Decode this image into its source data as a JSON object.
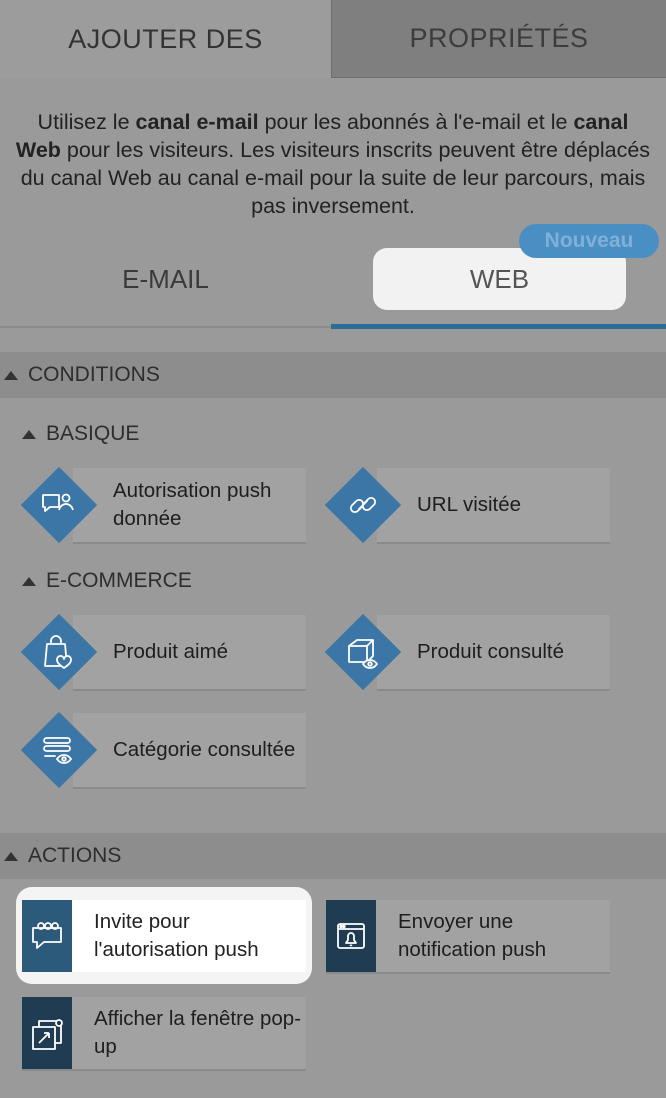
{
  "top_tabs": [
    "AJOUTER DES",
    "PROPRIÉTÉS"
  ],
  "intro": {
    "p1": "Utilisez le ",
    "b1": "canal e-mail",
    "p2": " pour les abonnés à l'e-mail et le ",
    "b2": "canal Web",
    "p3": " pour les visiteurs. Les visiteurs inscrits peuvent être déplacés du canal Web au canal e-mail pour la suite de leur parcours, mais pas inversement."
  },
  "channels": {
    "email": "E-MAIL",
    "web": "WEB",
    "badge": "Nouveau"
  },
  "conditions": {
    "title": "CONDITIONS",
    "basique": {
      "title": "BASIQUE",
      "items": [
        {
          "label": "Autorisation push donnée",
          "icon": "chat-user-icon"
        },
        {
          "label": "URL visitée",
          "icon": "link-icon"
        }
      ]
    },
    "ecommerce": {
      "title": "E-COMMERCE",
      "items": [
        {
          "label": "Produit aimé",
          "icon": "bag-heart-icon"
        },
        {
          "label": "Produit consulté",
          "icon": "box-eye-icon"
        },
        {
          "label": "Catégorie consultée",
          "icon": "list-eye-icon"
        }
      ]
    }
  },
  "actions": {
    "title": "ACTIONS",
    "items": [
      {
        "label": "Invite pour l'autorisation push",
        "icon": "chat-dots-icon"
      },
      {
        "label": "Envoyer une notification push",
        "icon": "bell-window-icon"
      },
      {
        "label": "Afficher la fenêtre pop-up",
        "icon": "popup-icon"
      }
    ]
  },
  "colors": {
    "accent": "#2f6d99",
    "diamond": "#3c76a6",
    "action_icon_bg": "#1f3c52",
    "badge": "#4a8fc4"
  }
}
